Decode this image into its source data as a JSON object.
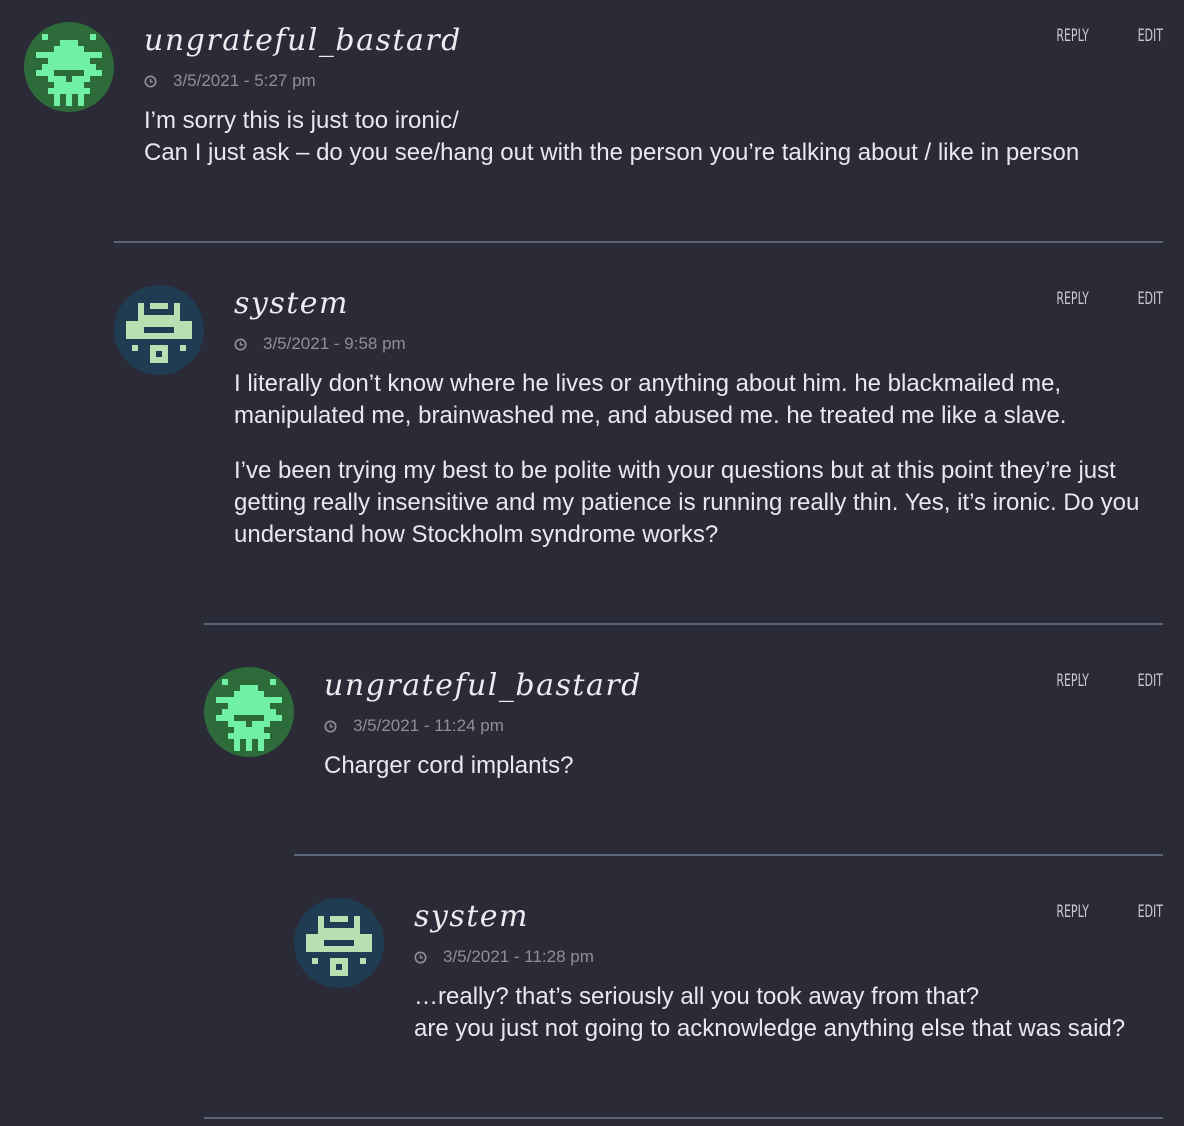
{
  "comments": [
    {
      "author": "ungrateful_bastard",
      "timestamp": "3/5/2021 - 5:27 pm",
      "reply_label": "Reply",
      "edit_label": "Edit",
      "avatar_icon": "space-invader-green-avatar",
      "avatar_colors": {
        "bg": "#2d6b3b",
        "fg": "#6ff0a3"
      },
      "paragraphs": [
        "I’m sorry this is just too ironic/\nCan I just ask – do you see/hang out with the person you’re talking about / like in person"
      ]
    },
    {
      "author": "system",
      "timestamp": "3/5/2021 - 9:58 pm",
      "reply_label": "Reply",
      "edit_label": "Edit",
      "avatar_icon": "space-invader-blue-avatar",
      "avatar_colors": {
        "bg": "#1f3c52",
        "fg": "#b6e0b2"
      },
      "paragraphs": [
        "I literally don’t know where he lives or anything about him. he blackmailed me, manipulated me, brainwashed me, and abused me. he treated me like a slave.",
        "I’ve been trying my best to be polite with your questions but at this point they’re just getting really insensitive and my patience is running really thin. Yes, it’s ironic. Do you understand how Stockholm syndrome works?"
      ]
    },
    {
      "author": "ungrateful_bastard",
      "timestamp": "3/5/2021 - 11:24 pm",
      "reply_label": "Reply",
      "edit_label": "Edit",
      "avatar_icon": "space-invader-green-avatar",
      "avatar_colors": {
        "bg": "#2d6b3b",
        "fg": "#6ff0a3"
      },
      "paragraphs": [
        "Charger cord implants?"
      ]
    },
    {
      "author": "system",
      "timestamp": "3/5/2021 - 11:28 pm",
      "reply_label": "Reply",
      "edit_label": "Edit",
      "avatar_icon": "space-invader-blue-avatar",
      "avatar_colors": {
        "bg": "#1f3c52",
        "fg": "#b6e0b2"
      },
      "paragraphs": [
        "…really? that’s seriously all you took away from that?\nare you just not going to acknowledge anything else that was said?"
      ]
    }
  ],
  "colors": {
    "background": "#2b2a37",
    "divider": "#5c6478",
    "meta_text": "#8f8e99"
  }
}
